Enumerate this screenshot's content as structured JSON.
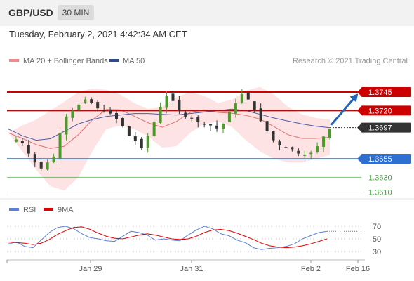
{
  "header": {
    "symbol": "GBP/USD",
    "timeframe": "30 MIN"
  },
  "datetime": "Tuesday, February 2, 2021 4:42:34 AM CET",
  "legend": {
    "ma20_label": "MA 20 + Bollinger Bands",
    "ma50_label": "MA 50",
    "copyright": "Research © 2021 Trading Central"
  },
  "colors": {
    "resistance": "#cc0000",
    "support": "#2f6fcf",
    "target": "#3cab3c",
    "last": "#333333",
    "bollinger_fill": "#fde3e3",
    "ma20": "#e07070",
    "ma50": "#4a5ea8",
    "arrow": "#2264b8",
    "candle_up": "#4c9a2a",
    "candle_down": "#333333",
    "rsi": "#5b7fd6",
    "rsi_ma": "#e00000"
  },
  "chart_data": [
    {
      "type": "candlestick",
      "title": "GBP/USD",
      "timeframe": "30 MIN",
      "x_ticks": [
        "Jan 29",
        "Jan 31",
        "Feb 2",
        "Feb 16"
      ],
      "ylim": [
        1.36,
        1.376
      ],
      "price_levels": [
        {
          "label": "1.3745",
          "value": 1.3745,
          "kind": "resistance",
          "boxed": true
        },
        {
          "label": "1.3720",
          "value": 1.372,
          "kind": "resistance",
          "boxed": true
        },
        {
          "label": "1.3697",
          "value": 1.3697,
          "kind": "last",
          "boxed": true
        },
        {
          "label": "1.3655",
          "value": 1.3655,
          "kind": "support",
          "boxed": true
        },
        {
          "label": "1.3630",
          "value": 1.363,
          "kind": "target",
          "boxed": false
        },
        {
          "label": "1.3610",
          "value": 1.361,
          "kind": "target",
          "boxed": false
        }
      ],
      "series": [
        {
          "name": "MA 20 + Bollinger Bands"
        },
        {
          "name": "MA 50"
        }
      ],
      "projection": {
        "from": 1.3697,
        "to": 1.3745,
        "direction": "up"
      },
      "close_path": [
        1.3678,
        1.3681,
        1.3676,
        1.3662,
        1.365,
        1.3642,
        1.365,
        1.3658,
        1.369,
        1.3712,
        1.372,
        1.3728,
        1.3735,
        1.373,
        1.3723,
        1.3719,
        1.3716,
        1.3709,
        1.3699,
        1.3686,
        1.3679,
        1.367,
        1.3686,
        1.3705,
        1.3725,
        1.374,
        1.3733,
        1.372,
        1.3712,
        1.371,
        1.3705,
        1.3702,
        1.37,
        1.3696,
        1.3702,
        1.3718,
        1.373,
        1.3742,
        1.3735,
        1.3721,
        1.3706,
        1.3692,
        1.368,
        1.3673,
        1.367,
        1.3668,
        1.3662,
        1.366,
        1.3663,
        1.3672,
        1.3685,
        1.3695
      ],
      "bollinger_upper": [
        1.369,
        1.37,
        1.3708,
        1.372,
        1.3732,
        1.3745,
        1.375,
        1.3748,
        1.3742,
        1.373,
        1.3722,
        1.3725,
        1.3738,
        1.3745,
        1.374,
        1.373,
        1.3735,
        1.3747,
        1.3752,
        1.3742,
        1.3725,
        1.3715,
        1.371,
        1.3708
      ],
      "bollinger_lower": [
        1.369,
        1.3665,
        1.364,
        1.3618,
        1.3612,
        1.363,
        1.3665,
        1.3695,
        1.37,
        1.3695,
        1.3685,
        1.367,
        1.3672,
        1.369,
        1.3702,
        1.3705,
        1.3698,
        1.368,
        1.3665,
        1.3655,
        1.365,
        1.365,
        1.3655,
        1.366
      ],
      "ma50": [
        1.3695,
        1.3686,
        1.368,
        1.3682,
        1.3692,
        1.3702,
        1.3708,
        1.3712,
        1.3714,
        1.3716,
        1.3716,
        1.3715,
        1.3714,
        1.3716,
        1.3718,
        1.372,
        1.3722,
        1.372,
        1.3715,
        1.371,
        1.3706,
        1.3702,
        1.3699,
        1.3697
      ]
    },
    {
      "type": "line",
      "title": "RSI",
      "series": [
        {
          "name": "RSI",
          "values": [
            42,
            45,
            38,
            36,
            48,
            60,
            68,
            70,
            66,
            58,
            52,
            50,
            47,
            46,
            54,
            62,
            60,
            56,
            48,
            50,
            48,
            47,
            56,
            64,
            70,
            66,
            58,
            55,
            48,
            44,
            36,
            33,
            35,
            36,
            38,
            42,
            50,
            55,
            60,
            62
          ]
        },
        {
          "name": "9MA",
          "values": [
            45,
            44,
            43,
            41,
            43,
            49,
            57,
            63,
            68,
            69,
            65,
            59,
            54,
            51,
            50,
            53,
            56,
            58,
            56,
            53,
            50,
            49,
            50,
            54,
            60,
            64,
            65,
            63,
            59,
            54,
            49,
            43,
            39,
            37,
            36,
            37,
            39,
            42,
            46,
            50
          ]
        }
      ],
      "y_ticks": [
        70,
        50,
        30
      ],
      "ylim": [
        20,
        80
      ]
    }
  ]
}
